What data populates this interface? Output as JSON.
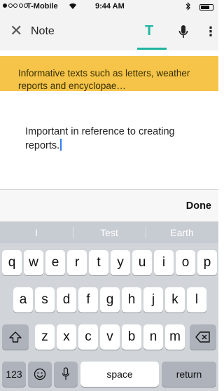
{
  "status_bar": {
    "carrier": "T-Mobile",
    "time": "9:44 AM"
  },
  "toolbar": {
    "title": "Note",
    "text_tab_label": "T",
    "more_label": "⋮"
  },
  "prompt": {
    "text": "Informative texts such as letters, weather reports and encyclopae…"
  },
  "note": {
    "text": "Important in reference to creating reports."
  },
  "done_bar": {
    "done_label": "Done"
  },
  "keyboard": {
    "suggestions": [
      "I",
      "Test",
      "Earth"
    ],
    "row1": [
      "q",
      "w",
      "e",
      "r",
      "t",
      "y",
      "u",
      "i",
      "o",
      "p"
    ],
    "row2": [
      "a",
      "s",
      "d",
      "f",
      "g",
      "h",
      "j",
      "k",
      "l"
    ],
    "row3": [
      "z",
      "x",
      "c",
      "v",
      "b",
      "n",
      "m"
    ],
    "numbers_label": "123",
    "space_label": "space",
    "return_label": "return"
  },
  "colors": {
    "accent": "#1fb5a0",
    "prompt_background": "#f5c449",
    "caret": "#2f7cf6"
  }
}
